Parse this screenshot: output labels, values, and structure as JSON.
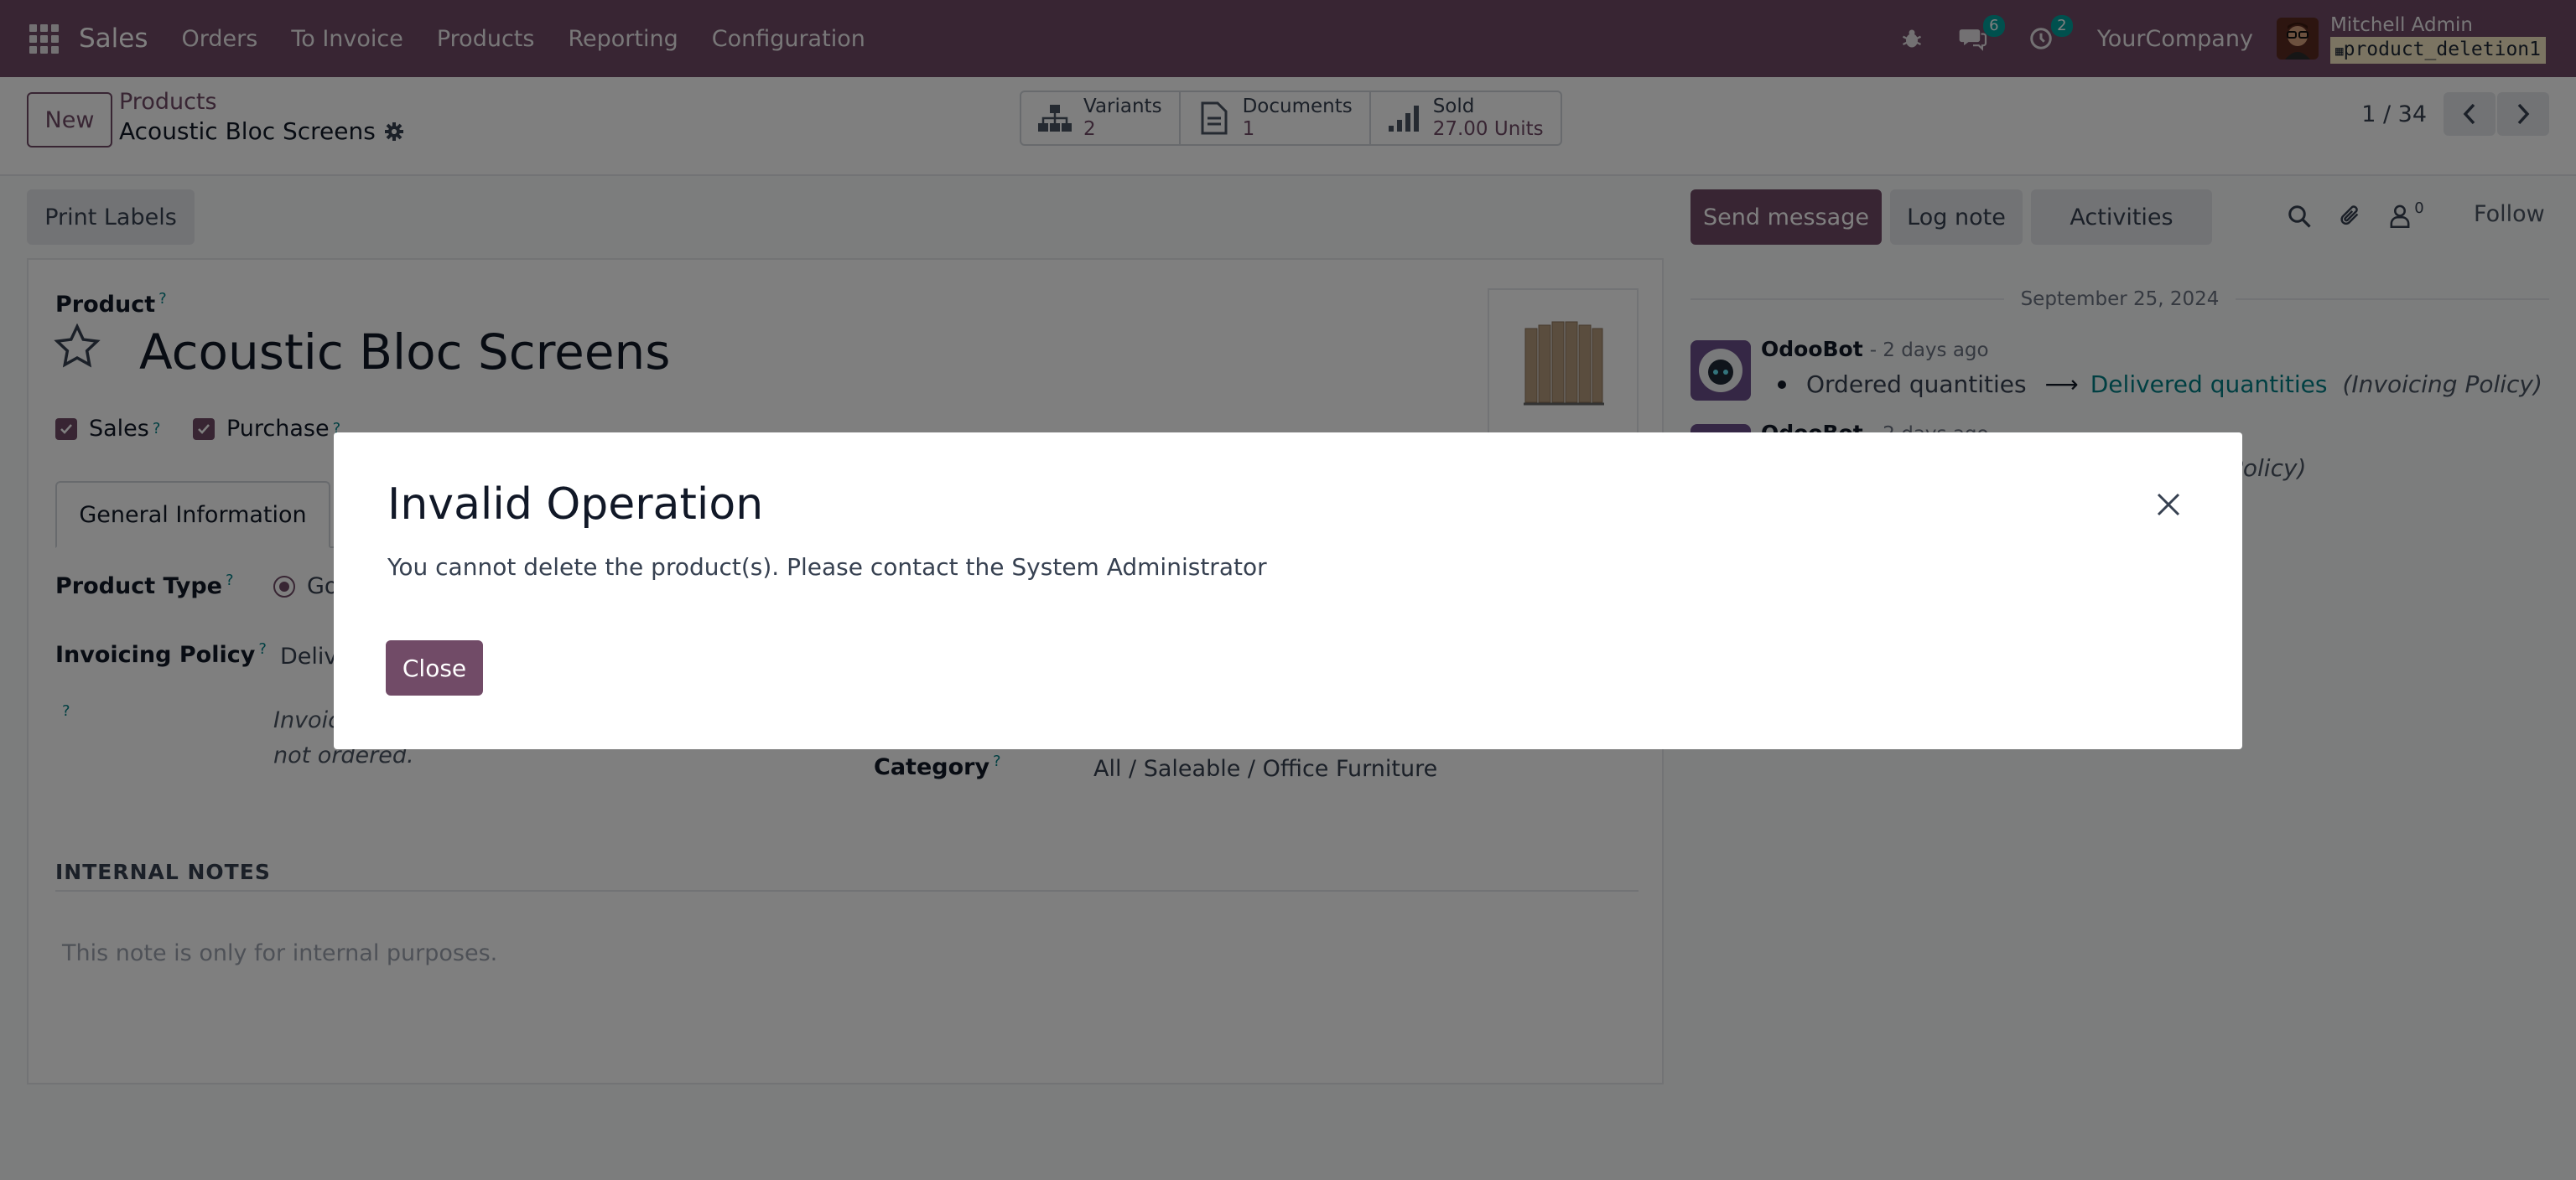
{
  "navbar": {
    "app_name": "Sales",
    "menu": [
      "Orders",
      "To Invoice",
      "Products",
      "Reporting",
      "Configuration"
    ],
    "messages_count": "6",
    "activities_count": "2",
    "company": "YourCompany",
    "user_name": "Mitchell Admin",
    "database": "product_deletion1"
  },
  "control": {
    "new_label": "New",
    "breadcrumb_root": "Products",
    "breadcrumb_current": "Acoustic Bloc Screens",
    "smart_buttons": [
      {
        "label": "Variants",
        "value": "2",
        "icon": "sitemap-icon"
      },
      {
        "label": "Documents",
        "value": "1",
        "icon": "document-icon"
      },
      {
        "label": "Sold",
        "value": "27.00 Units",
        "icon": "signal-bars-icon"
      }
    ],
    "pager": "1 / 34"
  },
  "form": {
    "print_labels": "Print Labels",
    "product_label": "Product",
    "product_name": "Acoustic Bloc Screens",
    "sales_label": "Sales",
    "purchase_label": "Purchase",
    "tab_general": "General Information",
    "product_type_label": "Product Type",
    "product_type_value": "Go",
    "invoicing_policy_label": "Invoicing Policy",
    "invoicing_policy_value": "Deliv",
    "invoicing_help_1": "Invoic",
    "invoicing_help_2": "not ordered.",
    "category_label": "Category",
    "category_value": "All / Saleable / Office Furniture",
    "internal_notes_title": "INTERNAL NOTES",
    "internal_notes_placeholder": "This note is only for internal purposes."
  },
  "chatter": {
    "send_message": "Send message",
    "log_note": "Log note",
    "activities": "Activities",
    "followers_count": "0",
    "follow": "Follow",
    "date": "September 25, 2024",
    "messages": [
      {
        "author": "OdooBot",
        "time": "- 2 days ago",
        "old": "Ordered quantities",
        "new": "Delivered quantities",
        "field": "(Invoicing Policy)"
      },
      {
        "author": "OdooBot",
        "time": "- 2 days ago",
        "field": "Policy)"
      }
    ]
  },
  "modal": {
    "title": "Invalid Operation",
    "body": "You cannot delete the product(s). Please contact the System Administrator",
    "close_button": "Close"
  },
  "colors": {
    "brand": "#714b67",
    "accent": "#017e84",
    "badge": "#00a09d"
  }
}
